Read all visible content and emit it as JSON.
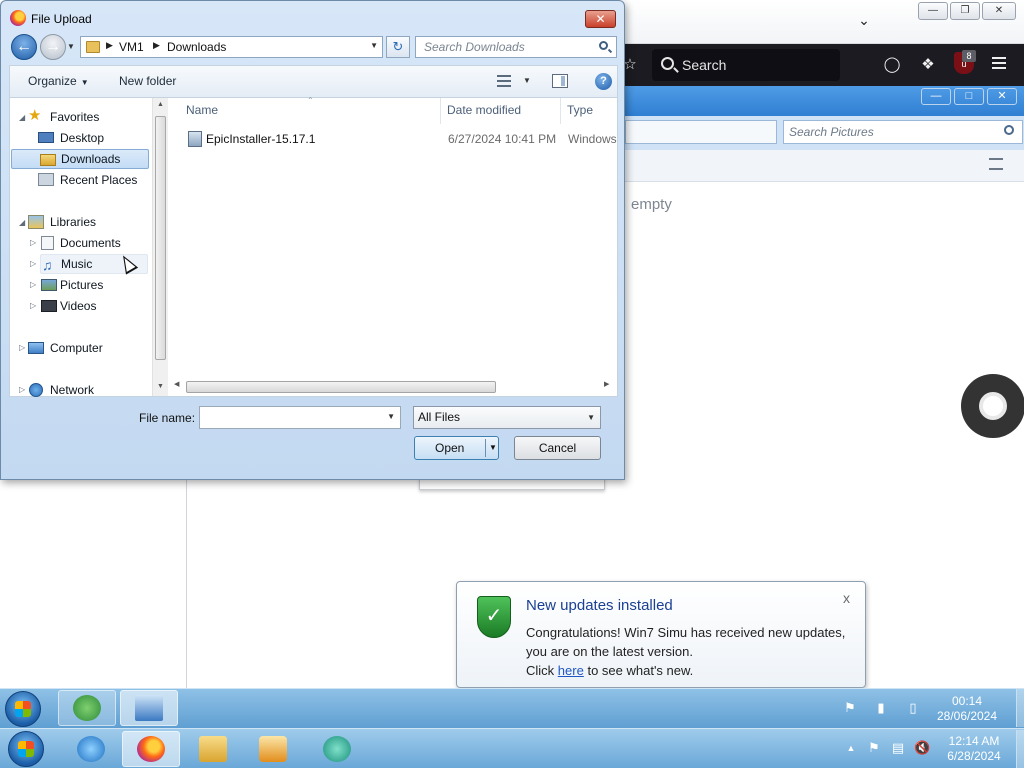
{
  "browser": {
    "search_label": "Search",
    "ublock_count": "8"
  },
  "inner_window": {
    "search_placeholder": "Search Pictures",
    "empty_text": "empty"
  },
  "dialog": {
    "title": "File Upload",
    "breadcrumb": [
      "VM1",
      "Downloads"
    ],
    "search_placeholder": "Search Downloads",
    "toolbar": {
      "organize_label": "Organize",
      "new_folder_label": "New folder"
    },
    "nav": {
      "favorites_label": "Favorites",
      "desktop_label": "Desktop",
      "downloads_label": "Downloads",
      "recent_places_label": "Recent Places",
      "libraries_label": "Libraries",
      "documents_label": "Documents",
      "music_label": "Music",
      "pictures_label": "Pictures",
      "videos_label": "Videos",
      "computer_label": "Computer",
      "network_label": "Network"
    },
    "columns": {
      "name": "Name",
      "date_modified": "Date modified",
      "type": "Type"
    },
    "files": [
      {
        "name": "EpicInstaller-15.17.1",
        "date_modified": "6/27/2024 10:41 PM",
        "type": "Windows"
      }
    ],
    "file_name_label": "File name:",
    "file_name_value": "",
    "file_type_filter": "All Files",
    "open_label": "Open",
    "cancel_label": "Cancel"
  },
  "notification": {
    "title": "New updates installed",
    "body_line1": "Congratulations! Win7 Simu has received new updates, you are on the latest version.",
    "click_text": "Click",
    "link_text": "here",
    "after_link": "to see what's new.",
    "close_label": "x"
  },
  "taskbar": {
    "clock_top_time": "00:14",
    "clock_top_date": "28/06/2024",
    "clock_bottom_time": "12:14 AM",
    "clock_bottom_date": "6/28/2024"
  }
}
